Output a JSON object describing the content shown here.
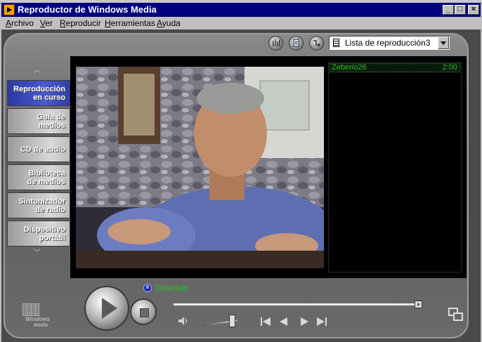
{
  "window": {
    "title": "Reproductor de Windows Media",
    "controls": {
      "minimize": "_",
      "maximize": "□",
      "close": "×"
    }
  },
  "menu": [
    {
      "label": "Archivo",
      "mnemonic": "A",
      "rest": "rchivo"
    },
    {
      "label": "Ver",
      "mnemonic": "V",
      "rest": "er"
    },
    {
      "label": "Reproducir",
      "mnemonic": "R",
      "rest": "eproducir"
    },
    {
      "label": "Herramientas",
      "mnemonic": "H",
      "rest": "erramientas"
    },
    {
      "label": "Ayuda",
      "mnemonic": "A",
      "rest": "yuda"
    }
  ],
  "toolbar": {
    "icons": [
      "equalizer-icon",
      "media-info-icon",
      "shuffle-icon"
    ],
    "playlist_selected": "Lista de reproducción3"
  },
  "nav": {
    "items": [
      {
        "line1": "Reproducción",
        "line2": "en curso",
        "active": true
      },
      {
        "line1": "Guía de",
        "line2": "medios",
        "active": false
      },
      {
        "line1": "CD de audio",
        "line2": "",
        "active": false
      },
      {
        "line1": "Biblioteca",
        "line2": "de medios",
        "active": false
      },
      {
        "line1": "Sintonizador",
        "line2": "de radio",
        "active": false
      },
      {
        "line1": "Dispositivo",
        "line2": "portátil",
        "active": false
      }
    ]
  },
  "playlist": {
    "items": [
      {
        "name": "Zeberio26",
        "duration": "2:00"
      }
    ]
  },
  "status": {
    "text": "Detenido"
  },
  "playback": {
    "seek_position": 1.0,
    "volume": 0.85
  },
  "logo": {
    "line1": "Windows",
    "line2": "Media"
  },
  "colors": {
    "accent_green": "#27c227",
    "title_bar": "#000080",
    "active_nav": "#3040a8"
  }
}
